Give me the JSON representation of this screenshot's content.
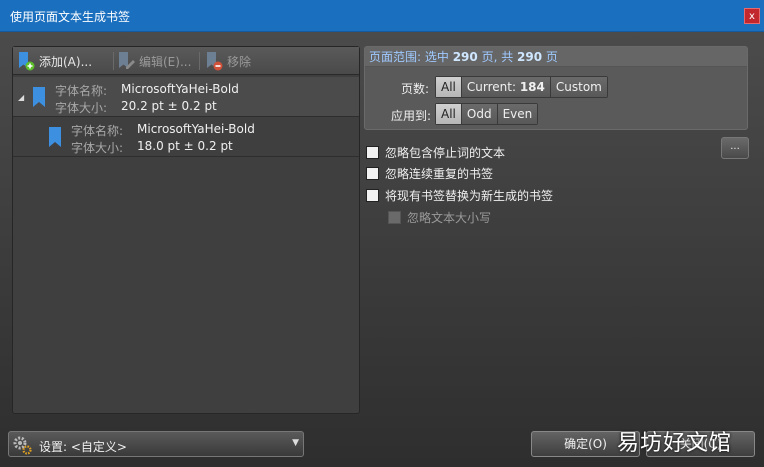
{
  "window": {
    "title": "使用页面文本生成书签",
    "close_label": "x"
  },
  "toolbar": {
    "add_label": "添加(A)...",
    "edit_label": "编辑(E)...",
    "remove_label": "移除"
  },
  "tree": {
    "nodes": [
      {
        "name_label": "字体名称:",
        "name_value": "MicrosoftYaHei-Bold",
        "size_label": "字体大小:",
        "size_value": "20.2 pt ± 0.2 pt"
      },
      {
        "name_label": "字体名称:",
        "name_value": "MicrosoftYaHei-Bold",
        "size_label": "字体大小:",
        "size_value": "18.0 pt ± 0.2 pt"
      }
    ]
  },
  "range": {
    "prefix": "页面范围: 选中 ",
    "selected": "290",
    "middle": " 页, 共 ",
    "total": "290",
    "suffix": " 页",
    "pages_label": "页数:",
    "pages_options": {
      "all": "All",
      "current_prefix": "Current: ",
      "current_value": "184",
      "custom": "Custom"
    },
    "apply_label": "应用到:",
    "apply_options": {
      "all": "All",
      "odd": "Odd",
      "even": "Even"
    }
  },
  "options": {
    "ignore_stopwords": "忽略包含停止词的文本",
    "ignore_repeated": "忽略连续重复的书签",
    "replace_existing": "将现有书签替换为新生成的书签",
    "ignore_case": "忽略文本大小写",
    "more_label": "..."
  },
  "footer": {
    "settings_label": "设置: <自定义>",
    "ok_label": "确定(O)",
    "cancel_label": "关闭(C)",
    "watermark": "易坊好文馆"
  },
  "colors": {
    "titlebar": "#1a6fbf",
    "bookmark": "#3d8fe0",
    "add_badge": "#5cbf2a",
    "remove_badge": "#d0503a"
  }
}
